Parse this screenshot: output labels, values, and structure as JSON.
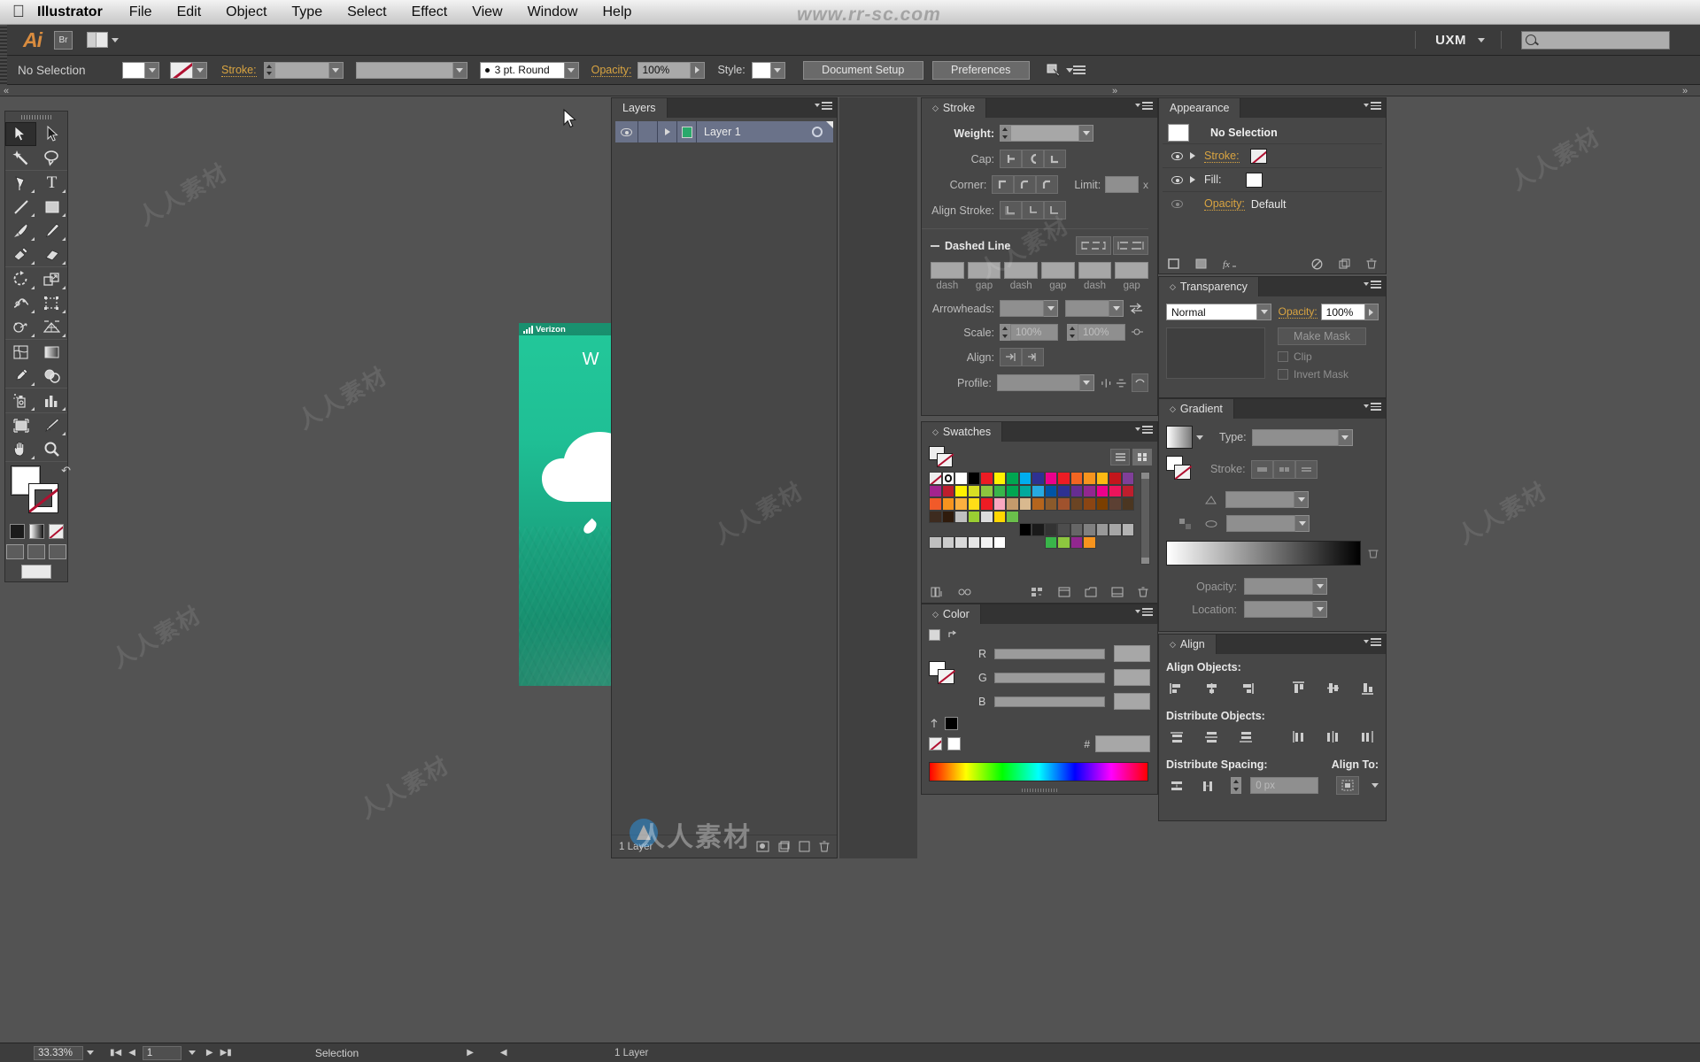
{
  "app": {
    "name": "Illustrator",
    "logo": "Ai",
    "bridge_label": "Br",
    "workspace": "UXM",
    "watermark_main": "www.rr-sc.com",
    "watermark_cn": "人人素材"
  },
  "menubar": {
    "apple": "apple-logo",
    "items": [
      "File",
      "Edit",
      "Object",
      "Type",
      "Select",
      "Effect",
      "View",
      "Window",
      "Help"
    ]
  },
  "control_bar": {
    "selection_status": "No Selection",
    "stroke_label": "Stroke:",
    "stroke_weight": "",
    "profile": "",
    "brush_def": "3 pt. Round",
    "opacity_label": "Opacity:",
    "opacity_value": "100%",
    "style_label": "Style:",
    "document_setup": "Document Setup",
    "preferences": "Preferences"
  },
  "tools": {
    "items": [
      {
        "name": "selection-tool",
        "glyph": "selection"
      },
      {
        "name": "direct-selection-tool",
        "glyph": "direct-selection"
      },
      {
        "name": "magic-wand-tool",
        "glyph": "magic-wand"
      },
      {
        "name": "lasso-tool",
        "glyph": "lasso"
      },
      {
        "name": "pen-tool",
        "glyph": "pen"
      },
      {
        "name": "type-tool",
        "glyph": "T"
      },
      {
        "name": "line-segment-tool",
        "glyph": "line"
      },
      {
        "name": "rectangle-tool",
        "glyph": "rectangle"
      },
      {
        "name": "paintbrush-tool",
        "glyph": "paintbrush"
      },
      {
        "name": "pencil-tool",
        "glyph": "pencil"
      },
      {
        "name": "blob-brush-tool",
        "glyph": "blob-brush"
      },
      {
        "name": "eraser-tool",
        "glyph": "eraser"
      },
      {
        "name": "rotate-tool",
        "glyph": "rotate"
      },
      {
        "name": "scale-tool",
        "glyph": "scale"
      },
      {
        "name": "width-tool",
        "glyph": "width"
      },
      {
        "name": "free-transform-tool",
        "glyph": "free-transform"
      },
      {
        "name": "shape-builder-tool",
        "glyph": "shape-builder"
      },
      {
        "name": "perspective-grid-tool",
        "glyph": "perspective-grid"
      },
      {
        "name": "mesh-tool",
        "glyph": "mesh"
      },
      {
        "name": "gradient-tool",
        "glyph": "gradient"
      },
      {
        "name": "eyedropper-tool",
        "glyph": "eyedropper"
      },
      {
        "name": "blend-tool",
        "glyph": "blend"
      },
      {
        "name": "symbol-sprayer-tool",
        "glyph": "symbol-sprayer"
      },
      {
        "name": "column-graph-tool",
        "glyph": "column-graph"
      },
      {
        "name": "artboard-tool",
        "glyph": "artboard"
      },
      {
        "name": "slice-tool",
        "glyph": "slice"
      },
      {
        "name": "hand-tool",
        "glyph": "hand"
      },
      {
        "name": "zoom-tool",
        "glyph": "zoom"
      }
    ],
    "fill_color": "#FFFFFF",
    "stroke_color": "none",
    "selected_index": 0
  },
  "artboard": {
    "carrier": "Verizon",
    "title": "W E",
    "weather_icon": "cloud-with-rain",
    "bg_top": "#23C89A",
    "bg_bottom": "#17906F"
  },
  "layers_panel": {
    "tab": "Layers",
    "layer_name": "Layer 1",
    "footer_count": "1 Layer",
    "icons": [
      "visibility-eye",
      "lock-column",
      "expand-triangle",
      "layer-thumbnail",
      "target-ring"
    ]
  },
  "stroke_panel": {
    "tab": "Stroke",
    "weight_label": "Weight:",
    "weight_value": "",
    "cap_label": "Cap:",
    "corner_label": "Corner:",
    "limit_label": "Limit:",
    "limit_unit": "x",
    "align_stroke_label": "Align Stroke:",
    "dashed_line_label": "Dashed Line",
    "dash_labels": [
      "dash",
      "gap",
      "dash",
      "gap",
      "dash",
      "gap"
    ],
    "arrowheads_label": "Arrowheads:",
    "scale_label": "Scale:",
    "scale_values": [
      "100%",
      "100%"
    ],
    "align_label": "Align:",
    "profile_label": "Profile:"
  },
  "swatches_panel": {
    "tab": "Swatches",
    "view_modes": [
      "list-view",
      "grid-view"
    ],
    "footer_icons": [
      "swatch-libraries",
      "show-swatch-kinds",
      "swatch-options",
      "new-color-group",
      "new-swatch",
      "delete-swatch"
    ],
    "rows": [
      [
        "#ffffff",
        "#000000",
        "#ffffff",
        "#000000",
        "#ed1c24",
        "#fff200",
        "#00a651",
        "#00aeef",
        "#2e3192",
        "#ec008c",
        "#ed1c24",
        "#f26522",
        "#f7941e",
        "#fdb913",
        "#c4161c",
        "#7f3f98",
        "#a3238e",
        "#be1e2d"
      ],
      [
        "#fff200",
        "#d7df23",
        "#8dc63f",
        "#39b54a",
        "#00a651",
        "#00a99d",
        "#27aae1",
        "#0054a6",
        "#2e3192",
        "#662d91",
        "#92278f",
        "#ec008c",
        "#ed145b",
        "#be1e2d",
        "#f15a29",
        "#f7941e",
        "#fbb040",
        "#ffde17"
      ],
      [
        "#ed1c24",
        "#f9a8c0",
        "#c49a6c",
        "#d9b98f",
        "#b5651d",
        "#8b5a2b",
        "#a0522d",
        "#6b4423",
        "#8b4513",
        "#7b3f00",
        "#5c4033",
        "#4b3621",
        "#3d2b1f",
        "#2f1b0c",
        "#c0c0c0",
        "#9acd32",
        "#dcdcdc",
        "#ffd700"
      ],
      [
        "#6abf4b",
        "",
        "",
        "",
        "",
        "",
        "",
        "",
        "",
        "",
        "",
        "",
        "",
        "",
        "",
        "",
        ""
      ],
      [
        "#000000",
        "#1a1a1a",
        "#333333",
        "#4d4d4d",
        "#666666",
        "#808080",
        "#999999",
        "#a6a6a6",
        "#b3b3b3",
        "#bfbfbf",
        "#cccccc",
        "#d9d9d9",
        "#e6e6e6",
        "#f2f2f2",
        "#ffffff",
        "",
        "",
        ""
      ],
      [
        "#39b54a",
        "#8dc63f",
        "#92278f",
        "#f7941e",
        "",
        "",
        "",
        "",
        "",
        "",
        "",
        "",
        "",
        "",
        "",
        "",
        ""
      ]
    ]
  },
  "color_panel": {
    "tab": "Color",
    "channels": [
      "R",
      "G",
      "B"
    ],
    "values": [
      "",
      "",
      ""
    ],
    "hex_label": "#",
    "hex_value": ""
  },
  "appearance_panel": {
    "tab": "Appearance",
    "selection": "No Selection",
    "rows": [
      {
        "label": "Stroke:",
        "value": "none-swatch"
      },
      {
        "label": "Fill:",
        "value": "white-swatch"
      },
      {
        "label": "Opacity:",
        "value": "Default"
      }
    ],
    "footer_icons": [
      "add-new-stroke",
      "add-new-fill",
      "add-new-effect",
      "clear-appearance",
      "duplicate-item",
      "delete-item"
    ]
  },
  "transparency_panel": {
    "tab": "Transparency",
    "blend_mode": "Normal",
    "opacity_label": "Opacity:",
    "opacity_value": "100%",
    "make_mask": "Make Mask",
    "clip": "Clip",
    "invert_mask": "Invert Mask"
  },
  "gradient_panel": {
    "tab": "Gradient",
    "type_label": "Type:",
    "type_value": "",
    "stroke_label": "Stroke:",
    "opacity_label": "Opacity:",
    "location_label": "Location:",
    "gradient_start": "#FFFFFF",
    "gradient_end": "#000000"
  },
  "align_panel": {
    "tab": "Align",
    "align_objects_label": "Align Objects:",
    "distribute_objects_label": "Distribute Objects:",
    "distribute_spacing_label": "Distribute Spacing:",
    "align_to_label": "Align To:",
    "spacing_value": "0 px"
  },
  "status_bar": {
    "zoom": "33.33%",
    "page": "1",
    "tool_status": "Selection",
    "layers_footer": "1 Layer"
  }
}
